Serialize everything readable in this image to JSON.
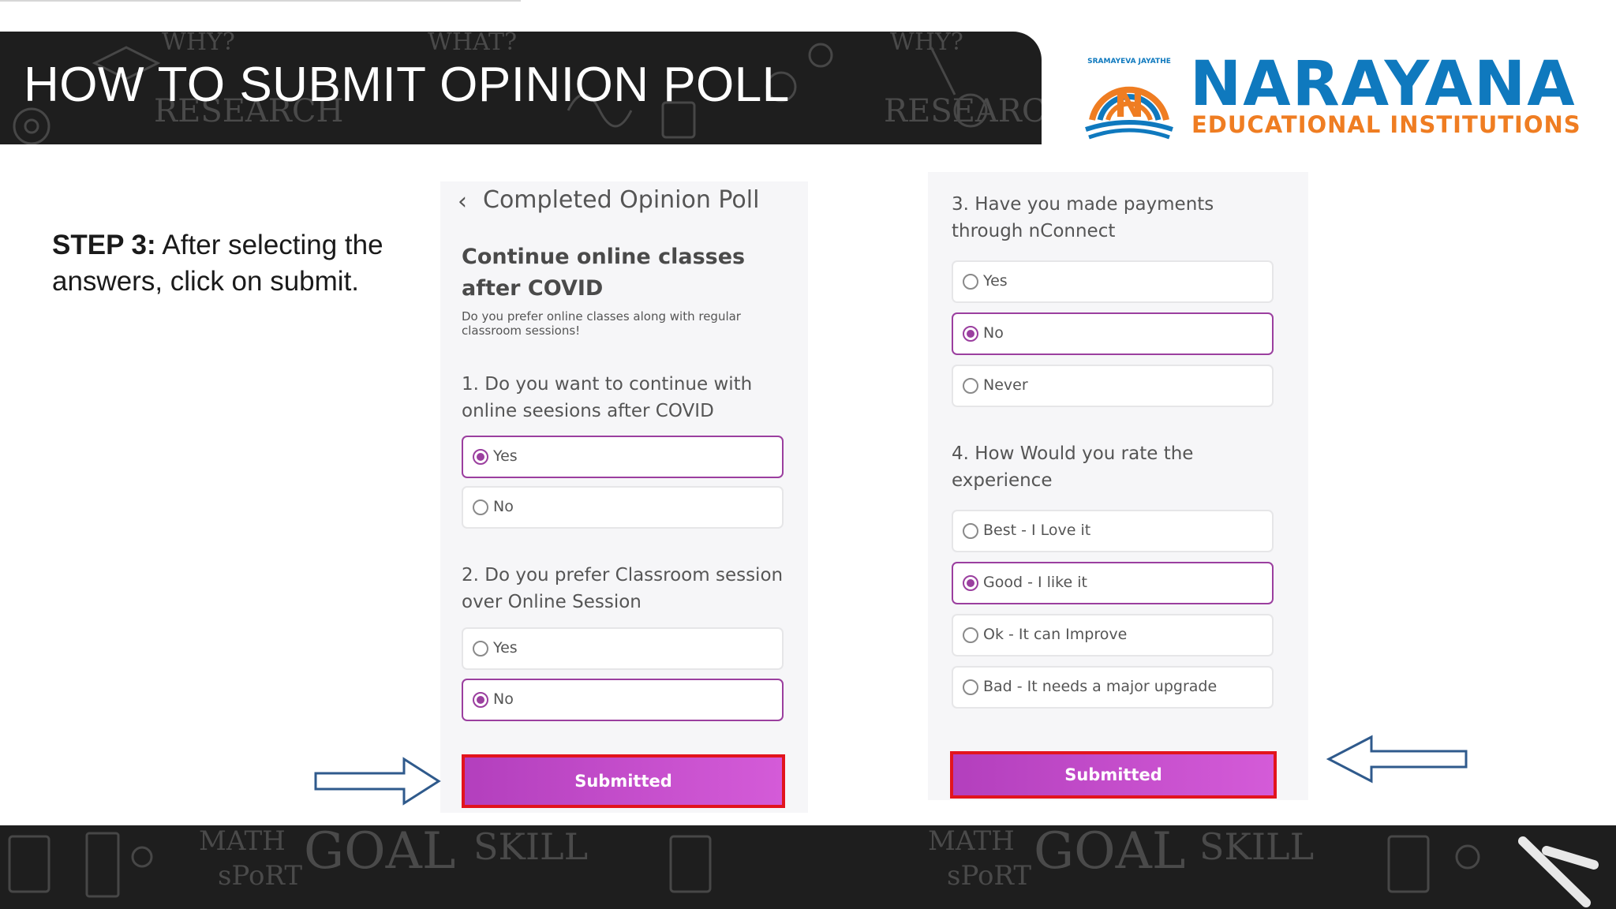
{
  "slide": {
    "title": "HOW TO SUBMIT OPINION POLL",
    "step_label": "STEP 3:",
    "step_text": " After selecting the answers, click on submit.",
    "banner_doodles": [
      "WHY?",
      "WHAT?",
      "RESEARCH",
      "WHY?",
      "RESEARCH"
    ],
    "footer_doodles": [
      "MATH",
      "sPoRT",
      "GOAL",
      "SKILL",
      "MATH",
      "sPoRT",
      "GOAL",
      "SKILL"
    ]
  },
  "logo": {
    "name": "NARAYANA",
    "subtitle": "EDUCATIONAL INSTITUTIONS",
    "emblem_text": "SRAMAYEVA JAYATHE",
    "emblem_letter": "N",
    "colors": {
      "blue": "#0f79be",
      "orange": "#ef7d22"
    }
  },
  "left_screen": {
    "header_title": "Completed Opinion Poll",
    "poll_title": "Continue online classes after COVID",
    "poll_description": "Do you prefer online classes along with regular classroom sessions!",
    "questions": [
      {
        "text": "1. Do you want to continue with online seesions after COVID",
        "options": [
          {
            "label": "Yes",
            "selected": true
          },
          {
            "label": "No",
            "selected": false
          }
        ]
      },
      {
        "text": "2. Do you prefer Classroom session over Online Session",
        "options": [
          {
            "label": "Yes",
            "selected": false
          },
          {
            "label": "No",
            "selected": true
          }
        ]
      }
    ],
    "submit_label": "Submitted"
  },
  "right_screen": {
    "questions": [
      {
        "text": "3. Have you made payments through nConnect",
        "options": [
          {
            "label": "Yes",
            "selected": false
          },
          {
            "label": "No",
            "selected": true
          },
          {
            "label": "Never",
            "selected": false
          }
        ]
      },
      {
        "text": "4. How Would you rate the experience",
        "options": [
          {
            "label": "Best - I Love it",
            "selected": false
          },
          {
            "label": "Good - I like it",
            "selected": true
          },
          {
            "label": "Ok - It can Improve",
            "selected": false
          },
          {
            "label": "Bad - It needs a major upgrade",
            "selected": false
          }
        ]
      }
    ],
    "submit_label": "Submitted"
  },
  "theme": {
    "accent": "#9b3f9f",
    "button_start": "#b33fbd",
    "button_end": "#d45bd8",
    "highlight_border": "#e2141d",
    "arrow_color": "#2f5a8c"
  }
}
